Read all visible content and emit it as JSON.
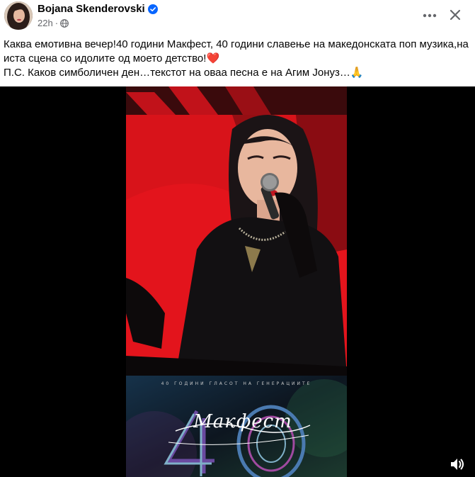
{
  "post": {
    "author": "Bojana Skenderovski",
    "timestamp": "22h",
    "separator": "·",
    "text_line1": "Каква емотивна вечер!40 години Макфест, 40 години славење на македонската поп музика,на иста сцена со идолите од моето детство!",
    "heart_emoji": "❤️",
    "text_line2": "П.С. Каков симболичен ден…текстот на оваа песна е на Агим Јонуз…",
    "pray_emoji": "🙏"
  },
  "video": {
    "banner_caption": "40 ГОДИНИ ГЛАСОТ НА ГЕНЕРАЦИИТЕ",
    "logo_text": "Макфест",
    "logo_number": "40"
  },
  "icons": {
    "verified": "verified-badge-icon",
    "globe": "globe-icon",
    "more": "more-horizontal-icon",
    "close": "close-icon",
    "volume": "volume-icon"
  },
  "colors": {
    "verified_blue": "#0866ff",
    "secondary_text": "#65676b",
    "stage_red": "#d8131a",
    "banner_bg": "#16324a"
  }
}
